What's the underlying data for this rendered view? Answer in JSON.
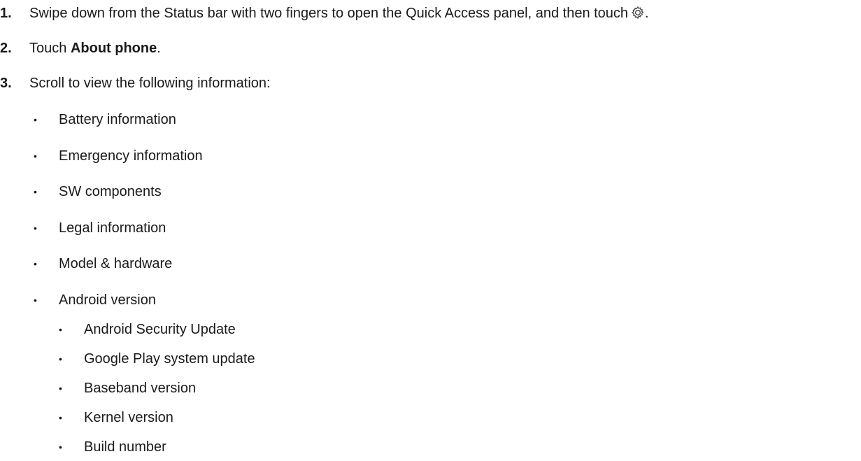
{
  "steps": [
    {
      "number": "1.",
      "text": "Swipe down from the Status bar with two fingers to open the Quick Access panel, and then touch",
      "trailing": ".",
      "icon": "settings-gear-icon"
    },
    {
      "number": "2.",
      "prefix": "Touch ",
      "bold": "About phone",
      "suffix": "."
    },
    {
      "number": "3.",
      "text": "Scroll to view the following information:"
    }
  ],
  "bullets": [
    "Battery information",
    "Emergency information",
    "SW components",
    "Legal information",
    "Model & hardware",
    "Android version"
  ],
  "sub_bullets": [
    "Android Security Update",
    "Google Play system update",
    "Baseband version",
    "Kernel version",
    "Build number"
  ],
  "bullet_glyph": "•"
}
